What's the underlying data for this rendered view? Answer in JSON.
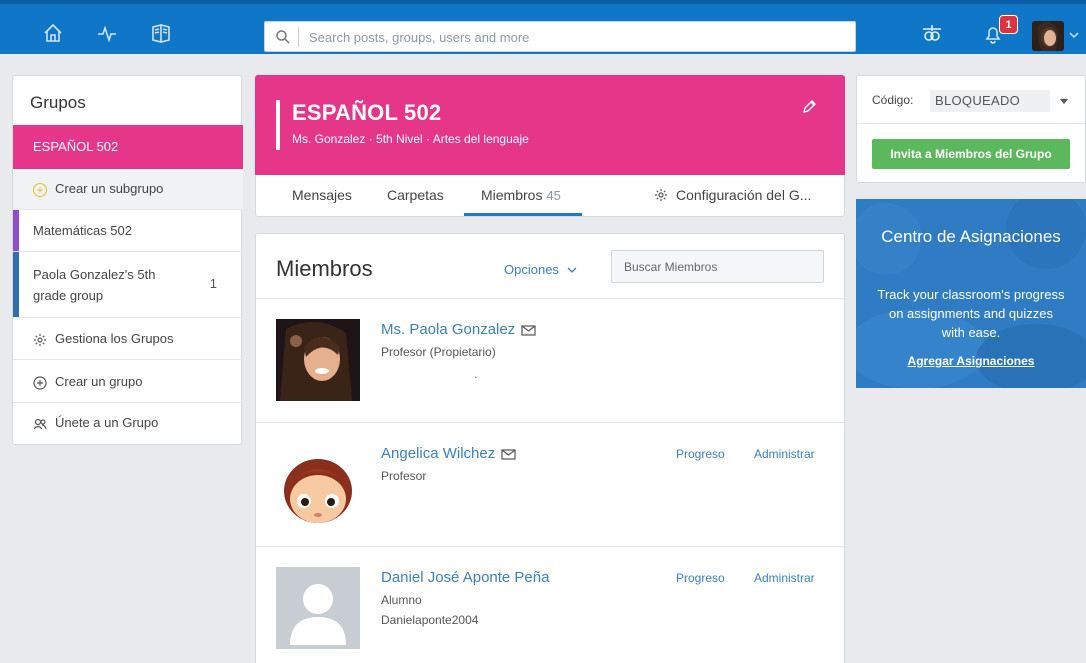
{
  "topbar": {
    "icons": [
      "home-icon",
      "activity-icon",
      "courses-icon",
      "backpack-icon",
      "bell-icon"
    ],
    "search_placeholder": "Search posts, groups, users and more",
    "notification_count": "1"
  },
  "sidebar": {
    "title": "Grupos",
    "active_group": "ESPAÑOL 502",
    "create_subgroup": "Crear un subgrupo",
    "groups": [
      {
        "label": "Matemáticas 502",
        "color": "#8e4fc9"
      },
      {
        "label": "Paola Gonzalez's 5th grade group",
        "count": "1",
        "color": "#2f6fae"
      }
    ],
    "manage": "Gestiona los Grupos",
    "create_group": "Crear un grupo",
    "join_group": "Únete a un Grupo"
  },
  "group": {
    "name": "ESPAÑOL 502",
    "meta": "Ms. Gonzalez · 5th Nivel · Artes del lenguaje",
    "color": "#e5368a"
  },
  "tabs": {
    "messages": "Mensajes",
    "folders": "Carpetas",
    "members": "Miembros",
    "members_count": "45",
    "settings": "Configuración del G..."
  },
  "members": {
    "heading": "Miembros",
    "options": "Opciones",
    "search_placeholder": "Buscar Miembros",
    "list": [
      {
        "name": "Ms. Paola Gonzalez",
        "role": "Profesor (Propietario)",
        "extra": ".",
        "progress": "",
        "admin": ""
      },
      {
        "name": "Angelica Wilchez",
        "role": "Profesor",
        "extra": "",
        "progress": "Progreso",
        "admin": "Administrar"
      },
      {
        "name": "Daniel José Aponte Peña",
        "role": "Alumno",
        "extra": "Danielaponte2004",
        "progress": "Progreso",
        "admin": "Administrar"
      }
    ]
  },
  "code": {
    "label": "Código:",
    "value": "BLOQUEADO",
    "invite_button": "Invita a Miembros del Grupo"
  },
  "promo": {
    "title": "Centro de Asignaciones",
    "body": "Track your classroom's progress on assignments and quizzes with ease.",
    "link": "Agregar Asignaciones"
  }
}
